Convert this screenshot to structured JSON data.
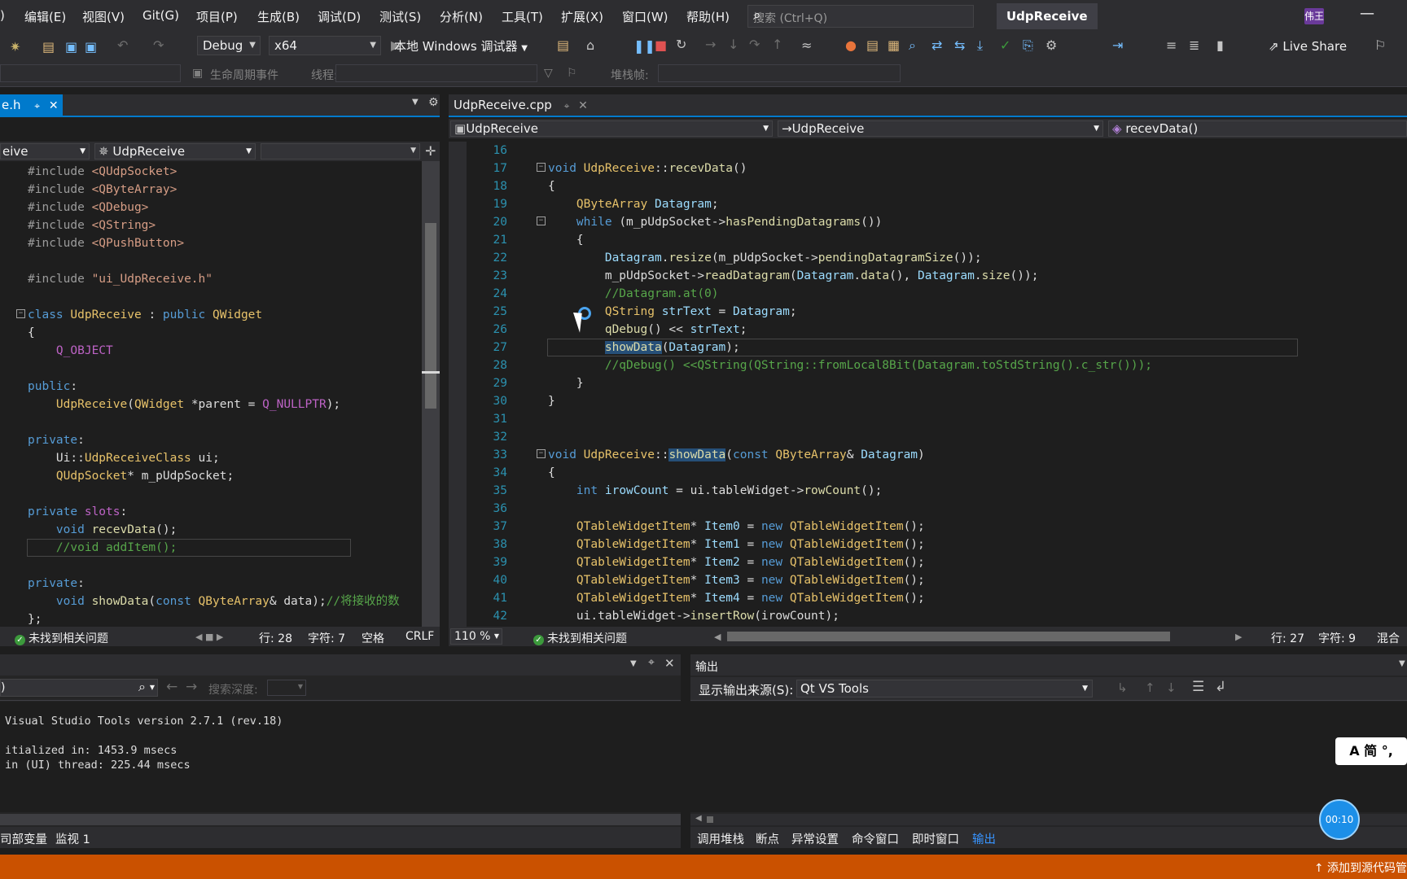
{
  "menu": [
    "编辑(E)",
    "视图(V)",
    "Git(G)",
    "项目(P)",
    "生成(B)",
    "调试(D)",
    "测试(S)",
    "分析(N)",
    "工具(T)",
    "扩展(X)",
    "窗口(W)",
    "帮助(H)"
  ],
  "menu_partial": ")",
  "search": {
    "placeholder": "搜索 (Ctrl+Q)"
  },
  "solution_name": "UdpReceive",
  "user_initials": "伟王",
  "toolbar": {
    "config": "Debug",
    "platform": "x64",
    "debugger_label": "本地 Windows 调试器",
    "live_share": "Live Share"
  },
  "debug_location": {
    "lifecycle_label": "生命周期事件",
    "thread_label": "线程:",
    "stackframe_label": "堆栈帧:"
  },
  "left_editor": {
    "tab_label": "e.h",
    "nav_project": "eive",
    "nav_class": "UdpReceive",
    "status_issues": "未找到相关问题",
    "line_label": "行: 28",
    "char_label": "字符: 7",
    "space_label": "空格",
    "eol_label": "CRLF"
  },
  "right_editor": {
    "tab_label": "UdpReceive.cpp",
    "nav_project": "UdpReceive",
    "nav_class": "UdpReceive",
    "nav_member": "recevData()",
    "zoom": "110 %",
    "status_issues": "未找到相关问题",
    "line_label": "行: 27",
    "char_label": "字符: 9",
    "mixed_label": "混合"
  },
  "find_panel": {
    "search_partial": ")",
    "depth_label": "搜索深度:",
    "output_lines": [
      "Visual Studio Tools version 2.7.1 (rev.18)",
      "",
      "itialized in: 1453.9 msecs",
      "in (UI) thread: 225.44 msecs"
    ],
    "tabs": [
      "司部变量",
      "监视 1"
    ]
  },
  "output_panel": {
    "title": "输出",
    "source_label": "显示输出来源(S):",
    "source_value": "Qt VS Tools",
    "tabs": [
      "调用堆栈",
      "断点",
      "异常设置",
      "命令窗口",
      "即时窗口",
      "输出"
    ]
  },
  "status_bar": {
    "add_source_control": "添加到源代码管"
  },
  "overlay": {
    "ime": "A 简 °,",
    "timer": "00:10"
  },
  "colors": {
    "accent": "#007acc",
    "statusbar": "#ca5100"
  }
}
